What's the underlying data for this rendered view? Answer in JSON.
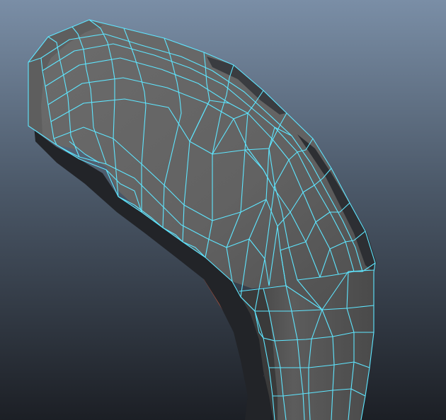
{
  "viewport": {
    "kind": "3d-modeling-viewport",
    "display_mode": "wireframe-on-shaded",
    "selection_state": "object-selected"
  },
  "colors": {
    "background_top": "#7a8ea6",
    "background_bottom": "#1c1f25",
    "wireframe": "#5ee6ff",
    "surface_light": "#6a6a6a",
    "surface_mid": "#5a5a5a",
    "surface_dark": "#3a3a3a",
    "surface_shadow": "#222428",
    "pivot_line": "#b4503a"
  }
}
